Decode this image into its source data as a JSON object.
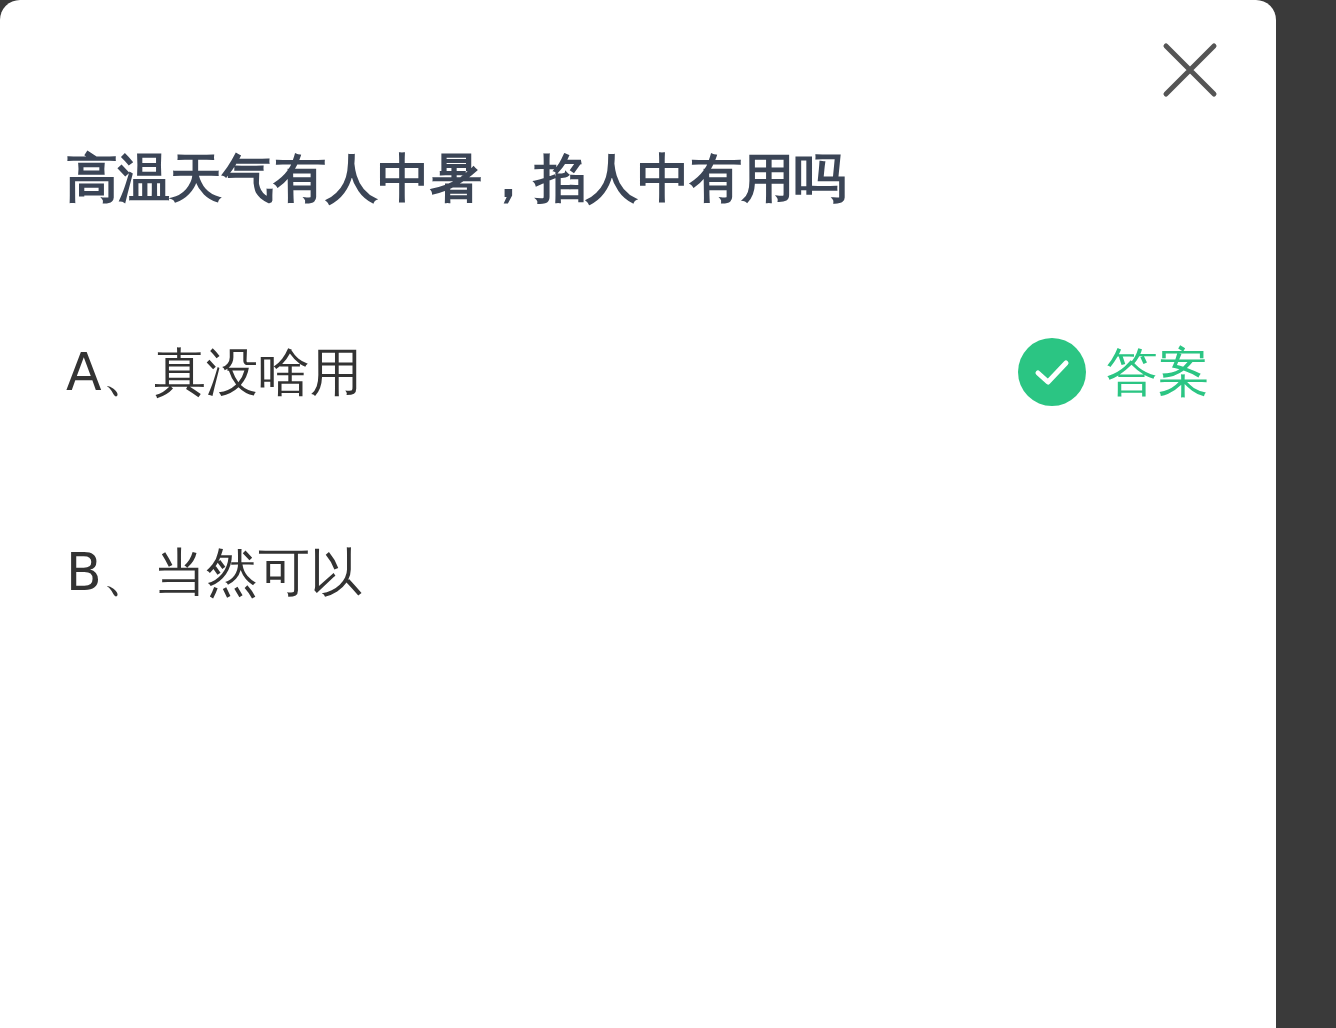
{
  "question": "高温天气有人中暑，掐人中有用吗",
  "options": [
    {
      "label": "A、真没啥用",
      "correct": true
    },
    {
      "label": "B、当然可以",
      "correct": false
    }
  ],
  "answer_label": "答案"
}
